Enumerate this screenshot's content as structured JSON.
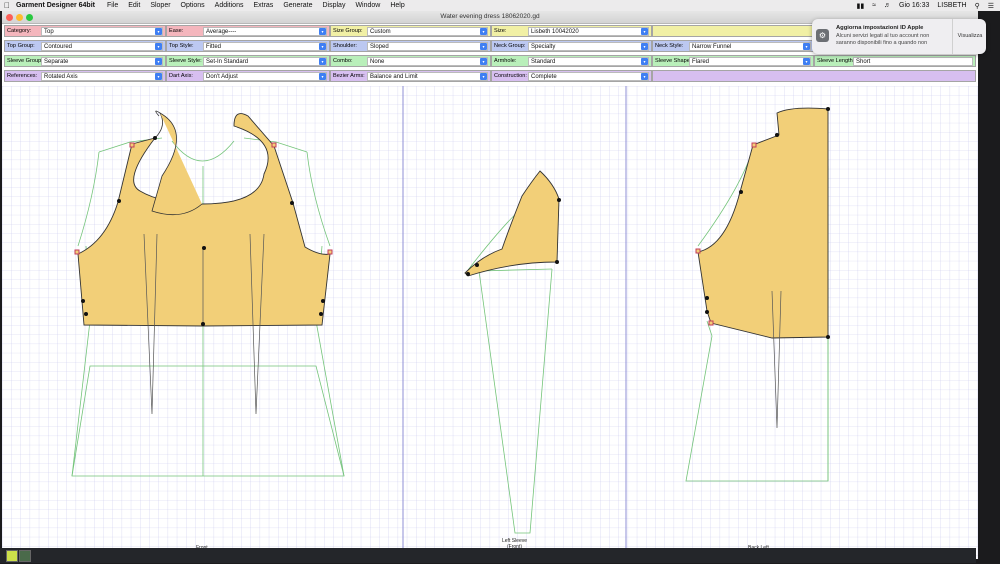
{
  "menubar": {
    "apple": "",
    "app_name": "Garment Designer 64bit",
    "items": [
      "File",
      "Edit",
      "Sloper",
      "Options",
      "Additions",
      "Extras",
      "Generate",
      "Display",
      "Window",
      "Help"
    ],
    "clock": "Gio 16:33",
    "user": "LISBETH"
  },
  "window": {
    "title": "Water evening dress 18062020.gd"
  },
  "controls": {
    "row1": [
      {
        "label": "Category:",
        "value": "Top",
        "color": "#f4b6bd"
      },
      {
        "label": "Ease:",
        "value": "Average----",
        "color": "#f4b6bd"
      },
      {
        "label": "Size Group:",
        "value": "Custom",
        "color": "#f1f0a5"
      },
      {
        "label": "Size:",
        "value": "Lisbeth 10042020",
        "color": "#f1f0a5"
      }
    ],
    "row2": [
      {
        "label": "Top Group:",
        "value": "Contoured"
      },
      {
        "label": "Top Style:",
        "value": "Fitted"
      },
      {
        "label": "Shoulder:",
        "value": "Sloped"
      },
      {
        "label": "Neck Group:",
        "value": "Specialty"
      },
      {
        "label": "Neck Style:",
        "value": "Narrow Funnel"
      }
    ],
    "row3": [
      {
        "label": "Sleeve Group:",
        "value": "Separate"
      },
      {
        "label": "Sleeve Style:",
        "value": "Set-In Standard"
      },
      {
        "label": "Combo:",
        "value": "None"
      },
      {
        "label": "Armhole:",
        "value": "Standard"
      },
      {
        "label": "Sleeve Shape:",
        "value": "Flared"
      },
      {
        "label": "Sleeve Length:",
        "value": "Short"
      }
    ],
    "row4": [
      {
        "label": "References:",
        "value": "Rotated Axis"
      },
      {
        "label": "Dart Axis:",
        "value": "Don't Adjust"
      },
      {
        "label": "Bezier Arms:",
        "value": "Balance and Limit"
      },
      {
        "label": "Construction:",
        "value": "Complete"
      }
    ]
  },
  "canvas": {
    "labels": {
      "front": "Front",
      "sleeve": "Left Sleeve\n(Front)",
      "back": "Back Left"
    },
    "pattern_fill": "#f2cf78",
    "grid_color": "#c9c9ee"
  },
  "notification": {
    "title": "Aggiorna impostazioni ID Apple",
    "body": "Alcuni servizi legati al tuo account non saranno disponibili fino a quando non",
    "button": "Visualizza"
  }
}
